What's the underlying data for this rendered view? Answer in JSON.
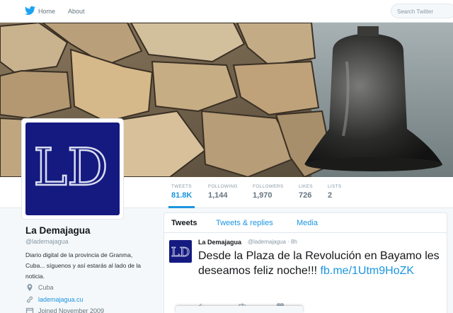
{
  "nav": {
    "home_label": "Home",
    "about_label": "About",
    "search_placeholder": "Search Twitter"
  },
  "stats": [
    {
      "label": "TWEETS",
      "value": "81.8K"
    },
    {
      "label": "FOLLOWING",
      "value": "1,144"
    },
    {
      "label": "FOLLOWERS",
      "value": "1,970"
    },
    {
      "label": "LIKES",
      "value": "726"
    },
    {
      "label": "LISTS",
      "value": "2"
    }
  ],
  "profile": {
    "avatar_text": "LD",
    "name": "La Demajagua",
    "handle": "@lademajagua",
    "bio": "Diario digital de la provincia de Granma, Cuba... síguenos y así estarás al lado de la noticia.",
    "location": "Cuba",
    "website": "lademajagua.cu",
    "joined": "Joined November 2009"
  },
  "timeline": {
    "tabs": [
      "Tweets",
      "Tweets & replies",
      "Media"
    ]
  },
  "tweet": {
    "avatar_text": "LD",
    "name": "La Demajagua",
    "handle": "@lademajagua · 8h",
    "text": "Desde la Plaza de la Revolución en Bayamo les deseamos feliz noche!!! ",
    "link": "fb.me/1Utm9HoZK"
  },
  "colors": {
    "accent": "#1b95e0",
    "avatar_bg": "#151a80",
    "twitter_blue": "#1da1f2"
  }
}
